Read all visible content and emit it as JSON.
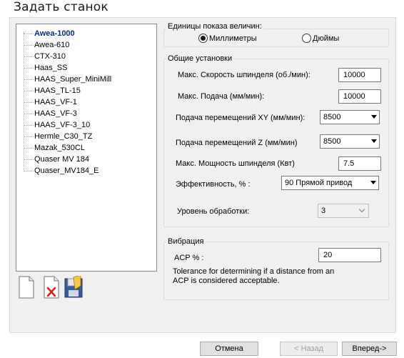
{
  "window": {
    "title": "Задать станок"
  },
  "machines": [
    "Awea-1000",
    "Awea-610",
    "CTX-310",
    "Haas_SS",
    "HAAS_Super_MiniMill",
    "HAAS_TL-15",
    "HAAS_VF-1",
    "HAAS_VF-3",
    "HAAS_VF-3_10",
    "Hermle_C30_TZ",
    "Mazak_530CL",
    "Quaser MV 184",
    "Quaser_MV184_E"
  ],
  "selected_machine": "Awea-1000",
  "toolbar": {
    "new_icon": "new-document-icon",
    "delete_icon": "delete-icon",
    "save_icon": "save-icon"
  },
  "units": {
    "title": "Единицы показа величин:",
    "mm_label": "Миллиметры",
    "in_label": "Дюймы",
    "selected": "Миллиметры"
  },
  "general": {
    "title": "Общие установки",
    "spindle_speed_label": "Макс. Скорость шпинделя (об./мин):",
    "spindle_speed_value": "10000",
    "feed_label": "Макс. Подача (мм/мин):",
    "feed_value": "10000",
    "xy_feed_label": "Подача перемещений XY (мм/мин):",
    "xy_feed_value": "8500",
    "z_feed_label": "Подача перемещений Z (мм/мин)",
    "z_feed_value": "8500",
    "power_label": "Макс. Мощность шпинделя (Квт)",
    "power_value": "7.5",
    "efficiency_label": "Эффективность, % :",
    "efficiency_value": "90 Прямой привод",
    "level_label": "Уровень обработки:",
    "level_value": "3"
  },
  "vibration": {
    "title": "Вибрация",
    "acp_label": "ACP % :",
    "acp_value": "20",
    "description": "Tolerance for determining if a distance from an ACP is considered acceptable."
  },
  "buttons": {
    "cancel": "Отмена",
    "back": "< Назад",
    "next": "Вперед->"
  }
}
